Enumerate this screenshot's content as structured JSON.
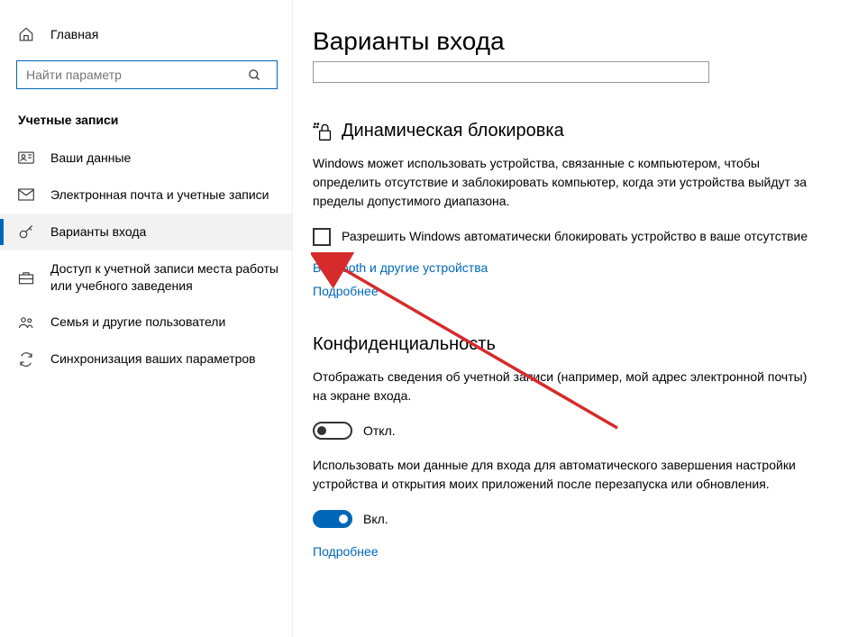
{
  "sidebar": {
    "home_label": "Главная",
    "search_placeholder": "Найти параметр",
    "group_title": "Учетные записи",
    "items": [
      {
        "icon": "user-badge",
        "label": "Ваши данные"
      },
      {
        "icon": "mail",
        "label": "Электронная почта и учетные записи"
      },
      {
        "icon": "key",
        "label": "Варианты входа",
        "active": true
      },
      {
        "icon": "briefcase",
        "label": "Доступ к учетной записи места работы или учебного заведения"
      },
      {
        "icon": "family",
        "label": "Семья и другие пользователи"
      },
      {
        "icon": "sync",
        "label": "Синхронизация ваших параметров"
      }
    ]
  },
  "main": {
    "page_title": "Варианты входа",
    "dynamic_lock": {
      "heading": "Динамическая блокировка",
      "description": "Windows может использовать устройства, связанные с компьютером, чтобы определить отсутствие и заблокировать компьютер, когда эти устройства выйдут за пределы допустимого диапазона.",
      "checkbox_label": "Разрешить Windows автоматически блокировать устройство в ваше отсутствие",
      "link_devices": "Bluetooth и другие устройства",
      "link_more": "Подробнее"
    },
    "privacy": {
      "heading": "Конфиденциальность",
      "show_account_desc": "Отображать сведения об учетной записи (например, мой адрес электронной почты) на экране входа.",
      "show_account_state": "Откл.",
      "use_signin_desc": "Использовать мои данные для входа для автоматического завершения настройки устройства и открытия моих приложений после перезапуска или обновления.",
      "use_signin_state": "Вкл.",
      "link_more": "Подробнее"
    }
  }
}
